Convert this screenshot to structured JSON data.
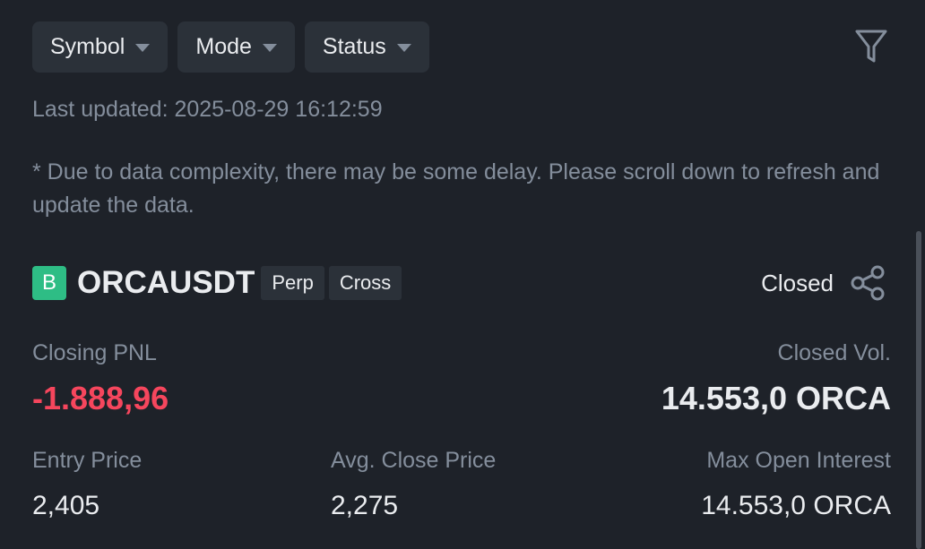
{
  "filters": {
    "symbol_label": "Symbol",
    "mode_label": "Mode",
    "status_label": "Status",
    "filter_icon": "funnel-icon"
  },
  "last_updated": "Last updated: 2025-08-29 16:12:59",
  "notice": "* Due to data complexity, there may be some delay. Please scroll down to refresh and update the data.",
  "position": {
    "badge": "B",
    "symbol": "ORCAUSDT",
    "tags": [
      "Perp",
      "Cross"
    ],
    "status": "Closed",
    "share_icon": "share-icon",
    "closing_pnl_label": "Closing PNL",
    "closing_pnl_value": "-1.888,96",
    "closed_vol_label": "Closed Vol.",
    "closed_vol_value": "14.553,0 ORCA",
    "entry_price_label": "Entry Price",
    "entry_price_value": "2,405",
    "avg_close_price_label": "Avg. Close Price",
    "avg_close_price_value": "2,275",
    "max_oi_label": "Max Open Interest",
    "max_oi_value": "14.553,0 ORCA"
  },
  "colors": {
    "background": "#1e2229",
    "surface": "#2b3139",
    "text_primary": "#eaecef",
    "text_secondary": "#848e9c",
    "negative": "#f6465d",
    "buy_badge": "#2ebd85"
  }
}
